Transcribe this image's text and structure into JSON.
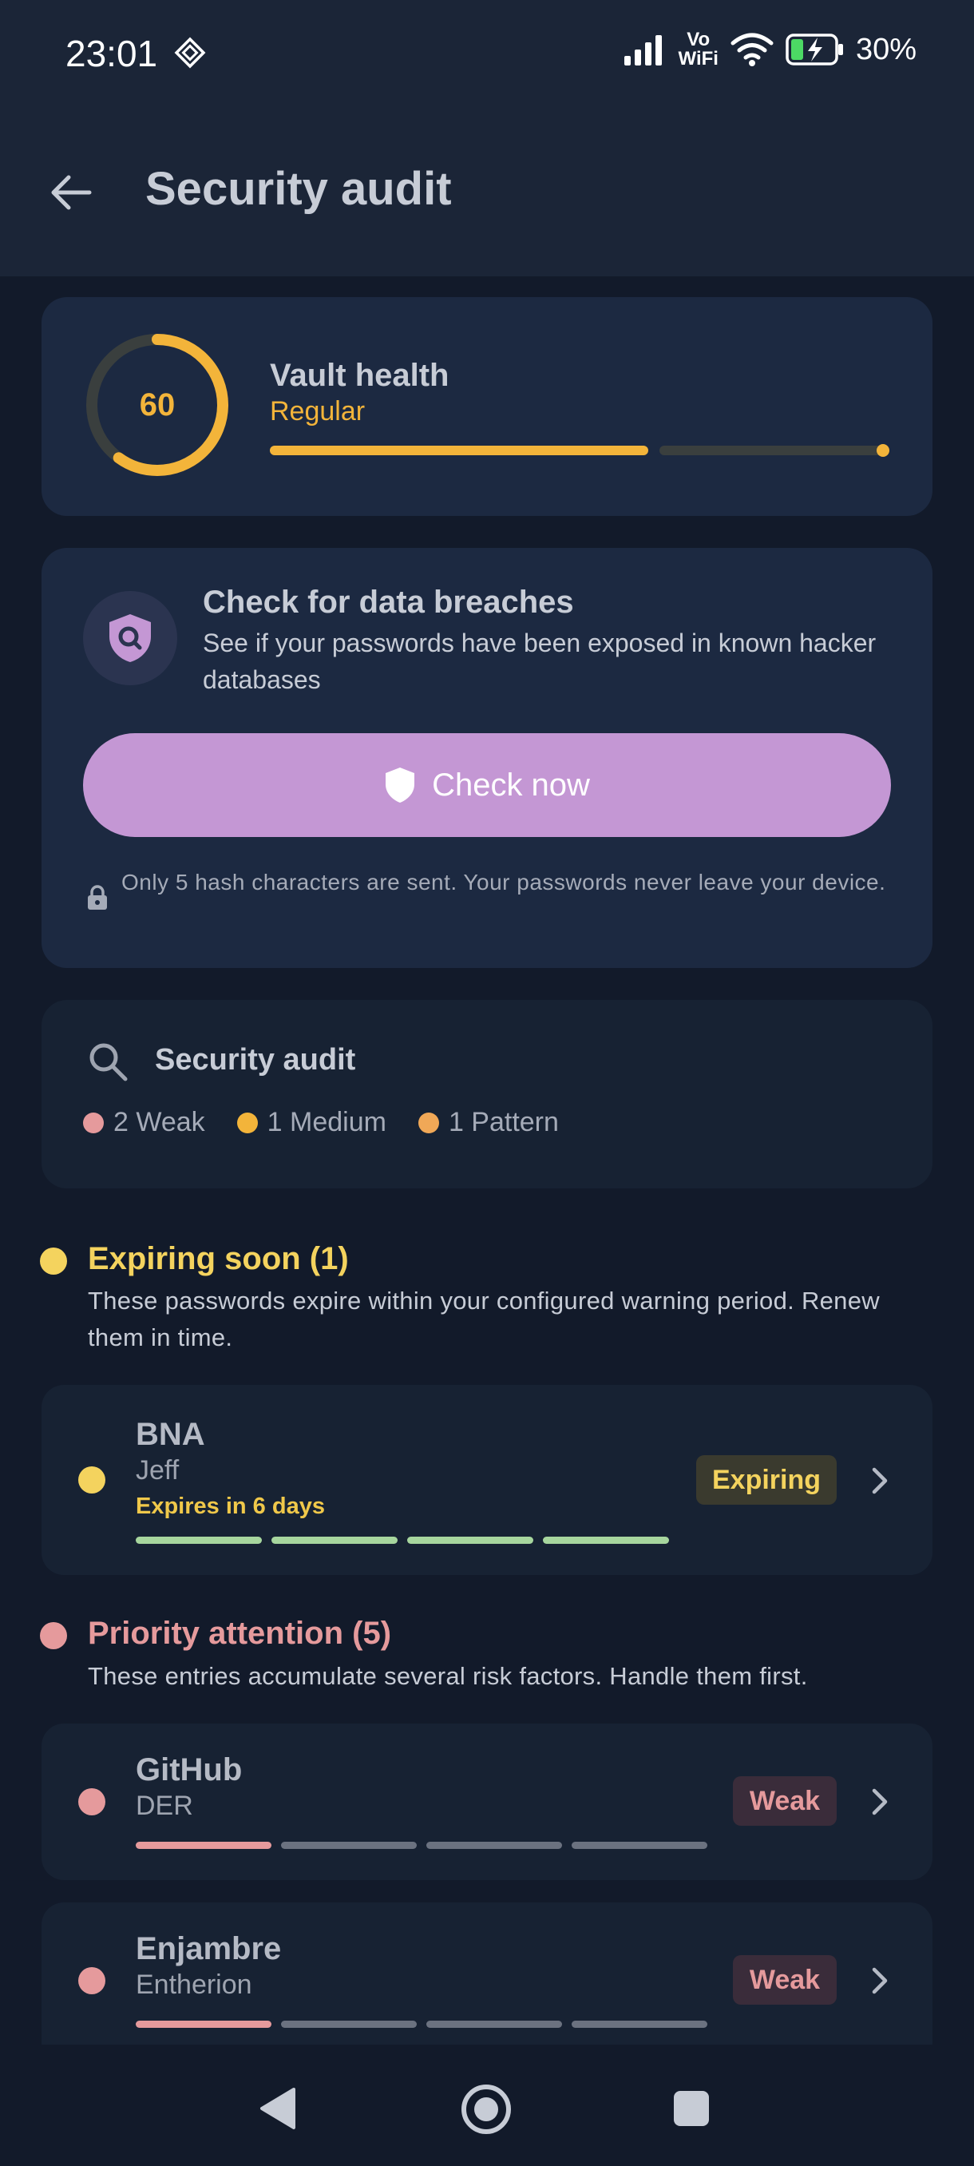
{
  "status_bar": {
    "time": "23:01",
    "vowifi_top": "Vo",
    "vowifi_bottom": "WiFi",
    "battery": "30%",
    "icons": [
      "diamond-icon",
      "signal-icon",
      "wifi-icon",
      "battery-charging-icon"
    ]
  },
  "app_bar": {
    "title": "Security audit",
    "back_icon": "arrow-back-icon"
  },
  "vault_health": {
    "score": "60",
    "score_value": 60,
    "title": "Vault health",
    "status": "Regular",
    "color": "#f3b43a"
  },
  "breach_check": {
    "title": "Check for data breaches",
    "description": "See if your passwords have been exposed in known hacker databases",
    "button_label": "Check now",
    "note": "Only 5 hash characters are sent. Your passwords never leave your device."
  },
  "audit_summary": {
    "title": "Security audit",
    "chips": [
      {
        "label": "2 Weak",
        "color": "#e59a9c"
      },
      {
        "label": "1 Medium",
        "color": "#f3b43a"
      },
      {
        "label": "1 Pattern",
        "color": "#f0a857"
      }
    ]
  },
  "expiring": {
    "title": "Expiring soon (1)",
    "description": "These passwords expire within your configured warning period. Renew them in time.",
    "color": "#f4d35e",
    "entries": [
      {
        "name": "BNA",
        "user": "Jeff",
        "expires": "Expires in 6 days",
        "badge": "Expiring",
        "strength": 4
      }
    ]
  },
  "priority": {
    "title": "Priority attention (5)",
    "description": "These entries accumulate several risk factors. Handle them first.",
    "color": "#e59a9c",
    "entries": [
      {
        "name": "GitHub",
        "user": "DER",
        "badge": "Weak",
        "strength": 1
      },
      {
        "name": "Enjambre",
        "user": "Entherion",
        "badge": "Weak",
        "strength": 1
      }
    ]
  }
}
